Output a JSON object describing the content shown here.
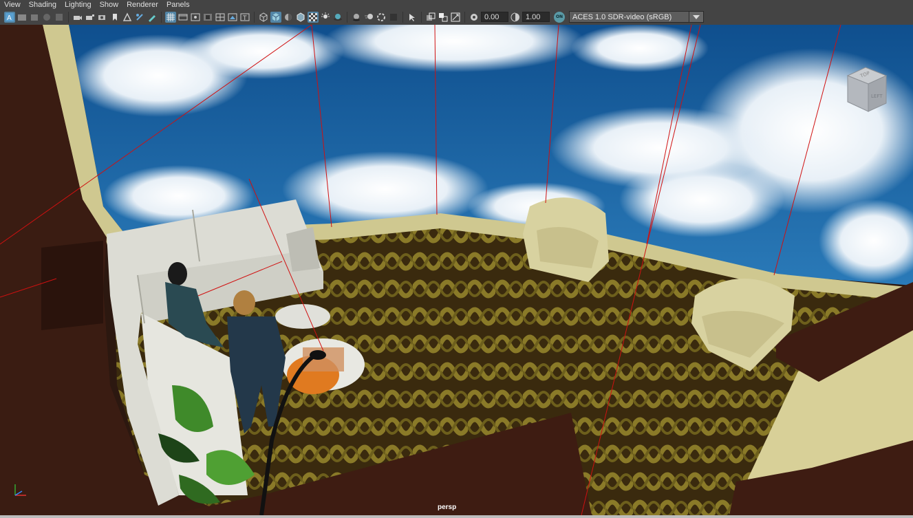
{
  "menu": {
    "items": [
      "View",
      "Shading",
      "Lighting",
      "Show",
      "Renderer",
      "Panels"
    ]
  },
  "toolbar": {
    "exposure_value": "0.00",
    "gamma_value": "1.00",
    "colormanage_badge": "ON",
    "view_transform_selected": "ACES 1.0 SDR-video (sRGB)"
  },
  "viewport": {
    "camera_label": "persp",
    "viewcube_face": "LEFT",
    "viewcube_top": "TOP"
  },
  "icons": [
    "select-camera-icon",
    "camera-attributes-icon",
    "bookmark-icon",
    "image-plane-icon",
    "grid-icon",
    "film-gate-icon",
    "resolution-gate-icon",
    "gate-mask-icon",
    "field-chart-icon",
    "safe-action-icon",
    "safe-title-icon",
    "wireframe-icon",
    "smooth-shade-icon",
    "default-material-icon",
    "wireframe-on-shaded-icon",
    "textured-icon",
    "use-all-lights-icon",
    "shadows-icon",
    "screen-space-ao-icon",
    "motion-blur-icon",
    "anti-aliasing-icon",
    "isolate-select-icon",
    "xray-icon",
    "xray-joints-icon",
    "xray-components-icon",
    "exposure-icon",
    "gamma-icon",
    "color-management-icon"
  ],
  "colors": {
    "ui_background": "#444444",
    "active_button": "#5285a6",
    "sky": "#1b5f9c",
    "carpet": "#3a2a10",
    "sofa": "#dcdcd4",
    "armchair": "#d8d2a0",
    "wall_trim": "#cfc890",
    "dark_wood": "#3e1c12",
    "camera_line": "#d01010"
  }
}
